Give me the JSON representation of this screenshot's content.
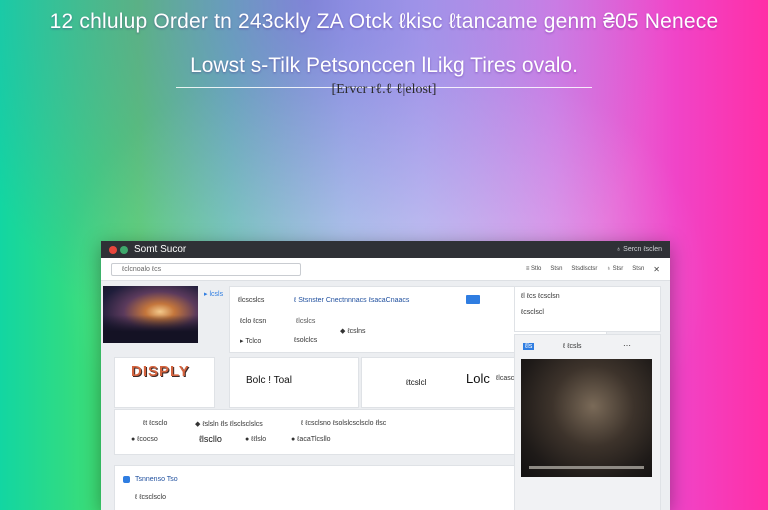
{
  "header": {
    "headline": "12 chlulup Order tn 243ckly ZA Otck ℓkisc ℓtancame genm ₴05 Nenece",
    "subhead": "Lowst s-Tilk Petsonccen lLikg Tires ovalo.",
    "tagline": "[Ervcr rℓ.ℓ ℓ|elost]"
  },
  "window": {
    "title": "Somt Sucor",
    "titlebar_right": "♁ Sercn ℓsclen",
    "search_placeholder": "ℓclcnoalo ℓcs",
    "toolbar_links": [
      "≡ Stlo",
      "Stsn",
      "Stsdlsctsr",
      "♁ Stsr",
      "Stsn"
    ],
    "panel1": {
      "link": "▸ lcsls",
      "title": "ℓ Stsnster Cnectnnnacs ℓsacaCnaacs",
      "line1": "ℓlcscslcs",
      "line2": "ℓclo ℓcsn",
      "line3": "◆ ℓcslns",
      "line4": "ℓlcslcs",
      "line5": "▸ Tclco",
      "line6": "ℓsolclcs"
    },
    "sticker": "DISPLY",
    "panel3_title": "Bolc ! Toal",
    "panel4_a": "ℓtcslcl",
    "panel4_b": "Lolc",
    "panel4_c": "ℓlcascsclcs",
    "panel5": {
      "r1c1": "ℓt ℓcsclo",
      "r1c2": "◆ ℓslsln ℓls ℓlsclsclslcs",
      "r1c3": "ℓ ℓcsclsno ℓsolslcsclsclo ℓlsc",
      "r2c1": "● ℓcocso",
      "r2c2": "ℓlscllo",
      "r2c3": "● ℓℓlslo",
      "r2c4": "● ℓacaTlcsllo"
    },
    "panel6_title": "Tsnnenso Tso",
    "panel6_line": "ℓ ℓcsclsclo",
    "right_top": {
      "l1": "ℓl ℓcs ℓcsclsn",
      "l2": "ℓcsclscl"
    },
    "video_badge": "ℓls",
    "video_meta": "ℓ ℓcsls"
  },
  "colors": {
    "accent_blue": "#2f7de1",
    "titlebar": "#2f3136",
    "red": "#e8463c",
    "green": "#3ea76b"
  }
}
